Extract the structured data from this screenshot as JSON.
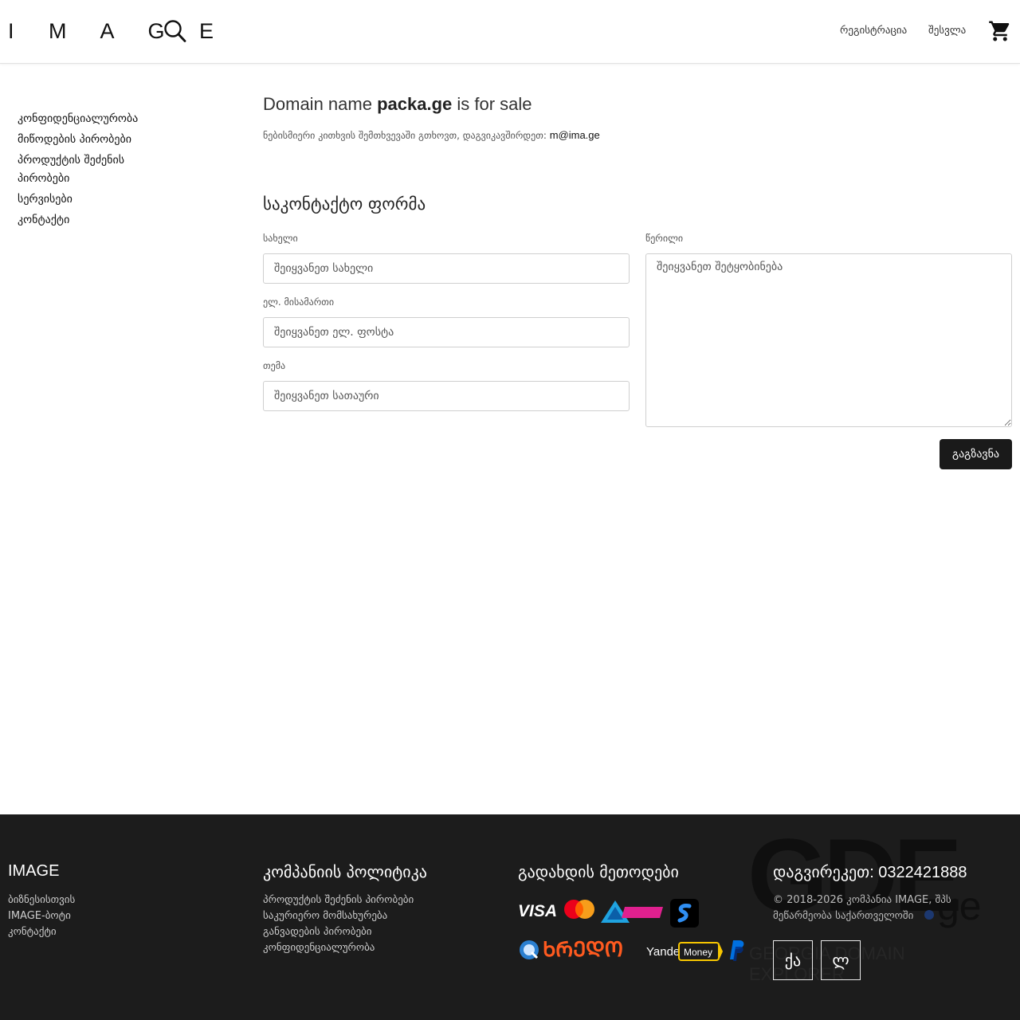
{
  "header": {
    "logo": "I M A G E",
    "register_label": "რეგისტრაცია",
    "login_label": "შესვლა"
  },
  "sidebar": {
    "items": [
      {
        "label": "კონფიდენციალურობა"
      },
      {
        "label": "მიწოდების პირობები"
      },
      {
        "label": "პროდუქტის შეძენის პირობები"
      },
      {
        "label": "სერვისები"
      },
      {
        "label": "კონტაქტი"
      }
    ]
  },
  "main": {
    "title_prefix": "Domain name ",
    "domain": "packa.ge",
    "title_suffix": " is for sale",
    "inquiry_text": "ნებისმიერი კითხვის შემთხვევაში გთხოვთ, დაგვიკავშირდეთ:",
    "email": "m@ima.ge"
  },
  "form": {
    "title": "საკონტაქტო ფორმა",
    "name_label": "სახელი",
    "name_placeholder": "შეიყვანეთ სახელი",
    "email_label": "ელ. მისამართი",
    "email_placeholder": "შეიყვანეთ ელ. ფოსტა",
    "subject_label": "თემა",
    "subject_placeholder": "შეიყვანეთ სათაური",
    "message_label": "წერილი",
    "message_placeholder": "შეიყვანეთ შეტყობინება",
    "send_label": "გაგზავნა"
  },
  "footer": {
    "col1": {
      "heading": "IMAGE",
      "links": [
        "ბიზნესისთვის",
        "IMAGE-ბოტი",
        "კონტაქტი"
      ]
    },
    "col2": {
      "heading": "კომპანიის პოლიტიკა",
      "links": [
        "პროდუქტის შეძენის პირობები",
        "საკურიერო მომსახურება",
        "განვადების პირობები",
        "კონფიდენციალურობა"
      ]
    },
    "col3": {
      "heading": "გადახდის მეთოდები",
      "payment_logos": [
        "visa",
        "mastercard",
        "tbc-pay",
        "payze",
        "qiwi",
        "kredo",
        "yandex-money",
        "paypal"
      ],
      "logo_texts": {
        "visa": "VISA",
        "kredo": "ᲮᲠᲔᲓᲝ",
        "yandex": "Yandex",
        "money": "Money"
      }
    },
    "col4": {
      "heading": "დაგვირეკეთ: 0322421888",
      "copyright": "© 2018-2026 კომპანია IMAGE, შპს მეწარმეობა საქართველოში"
    },
    "watermark": {
      "big": "GDE",
      "ge": "ge",
      "tagline": "GEORGIA DOMAIN EXPLORER"
    },
    "lang_buttons": [
      "ქა",
      "ლ"
    ]
  },
  "colors": {
    "accent_dark": "#1a1a1a",
    "footer_bg": "#1c1c1c",
    "gde_blue": "#1e5bd6"
  }
}
